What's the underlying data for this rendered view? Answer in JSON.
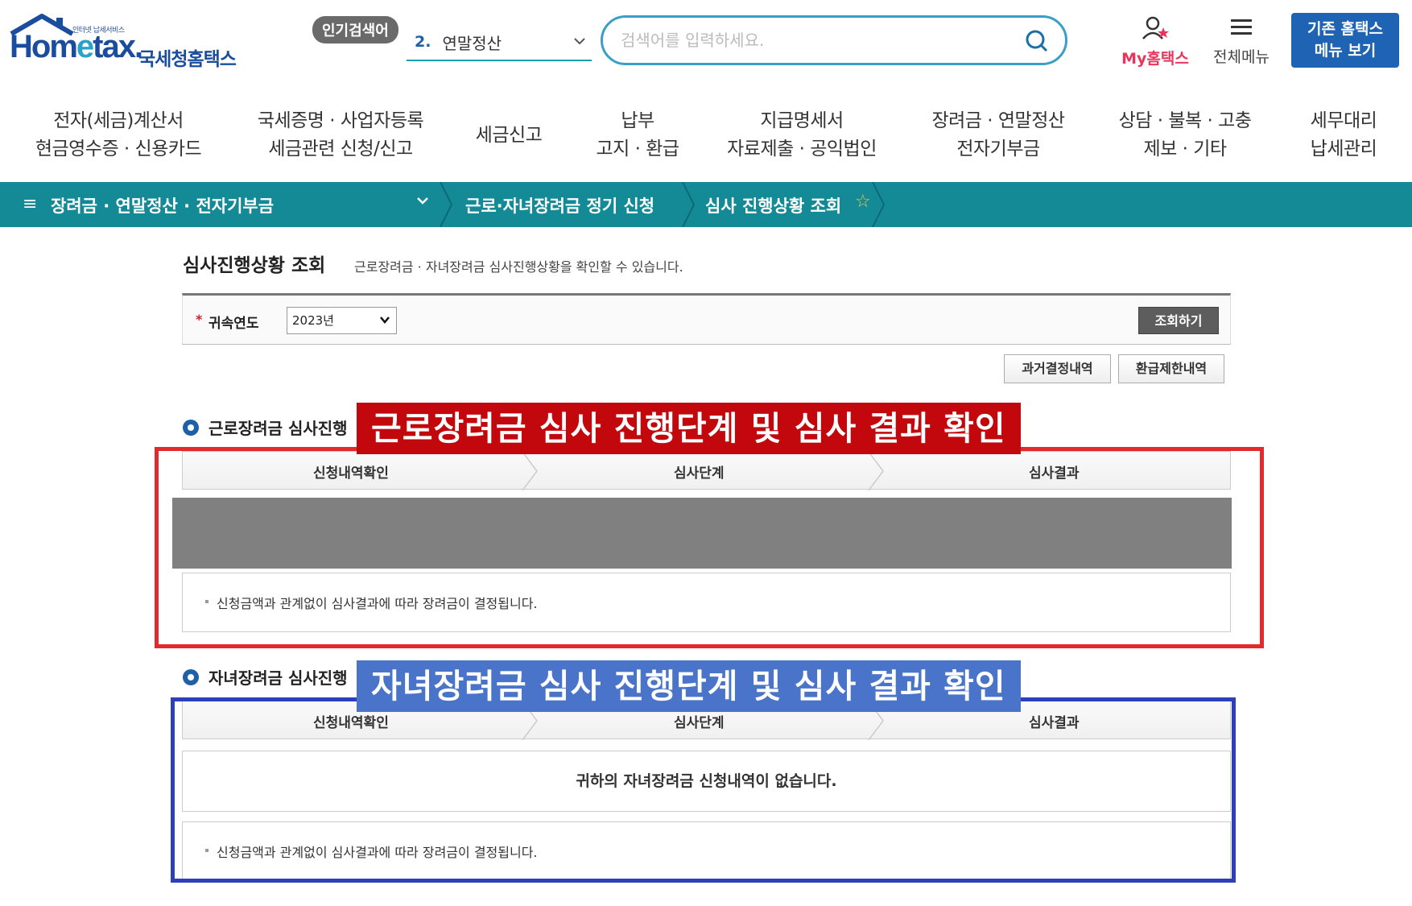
{
  "header": {
    "logo_small": "인터넷 납세서비스",
    "logo_main_a": "Hom",
    "logo_main_e": "e",
    "logo_main_b": "tax.",
    "logo_kr": "국세청홈택스",
    "popular_badge": "인기검색어",
    "popular_num": "2.",
    "popular_text": "연말정산",
    "search_placeholder": "검색어를 입력하세요.",
    "my_hometax": "My홈택스",
    "all_menu": "전체메뉴",
    "legacy_line1": "기존 홈택스",
    "legacy_line2": "메뉴 보기"
  },
  "mainnav": [
    {
      "l1": "전자(세금)계산서",
      "l2": "현금영수증 · 신용카드"
    },
    {
      "l1": "국세증명 · 사업자등록",
      "l2": "세금관련 신청/신고"
    },
    {
      "l1": "세금신고",
      "l2": ""
    },
    {
      "l1": "납부",
      "l2": "고지 · 환급"
    },
    {
      "l1": "지급명세서",
      "l2": "자료제출 · 공익법인"
    },
    {
      "l1": "장려금 · 연말정산",
      "l2": "전자기부금"
    },
    {
      "l1": "상담 · 불복 · 고충",
      "l2": "제보 · 기타"
    },
    {
      "l1": "세무대리",
      "l2": "납세관리"
    }
  ],
  "breadcrumb": {
    "level1": "장려금 · 연말정산 · 전자기부금",
    "level2": "근로·자녀장려금 정기 신청",
    "level3": "심사 진행상황 조회"
  },
  "page": {
    "title": "심사진행상황 조회",
    "description": "근로장려금 · 자녀장려금 심사진행상황을 확인할 수 있습니다.",
    "filter_required_mark": "*",
    "filter_label": "귀속연도",
    "filter_year": "2023년",
    "search_button": "조회하기",
    "past_decisions_button": "과거결정내역",
    "refund_limit_button": "환급제한내역"
  },
  "sections": {
    "work": {
      "title": "근로장려금 심사진행",
      "steps": [
        "신청내역확인",
        "심사단계",
        "심사결과"
      ],
      "note": "신청금액과 관계없이 심사결과에 따라 장려금이 결정됩니다."
    },
    "child": {
      "title": "자녀장려금 심사진행",
      "steps": [
        "신청내역확인",
        "심사단계",
        "심사결과"
      ],
      "empty_message": "귀하의 자녀장려금 신청내역이 없습니다.",
      "note": "신청금액과 관계없이 심사결과에 따라 장려금이 결정됩니다."
    }
  },
  "annotations": {
    "red_banner": "근로장려금 심사 진행단계 및 심사 결과 확인",
    "blue_banner": "자녀장려금 심사 진행단계 및 심사 결과 확인",
    "red_color": "#c2080c",
    "blue_color": "#4a74c9"
  },
  "colors": {
    "brand_blue": "#1b4d9e",
    "breadcrumb_teal": "#138a95",
    "accent_pink": "#e8355a"
  }
}
